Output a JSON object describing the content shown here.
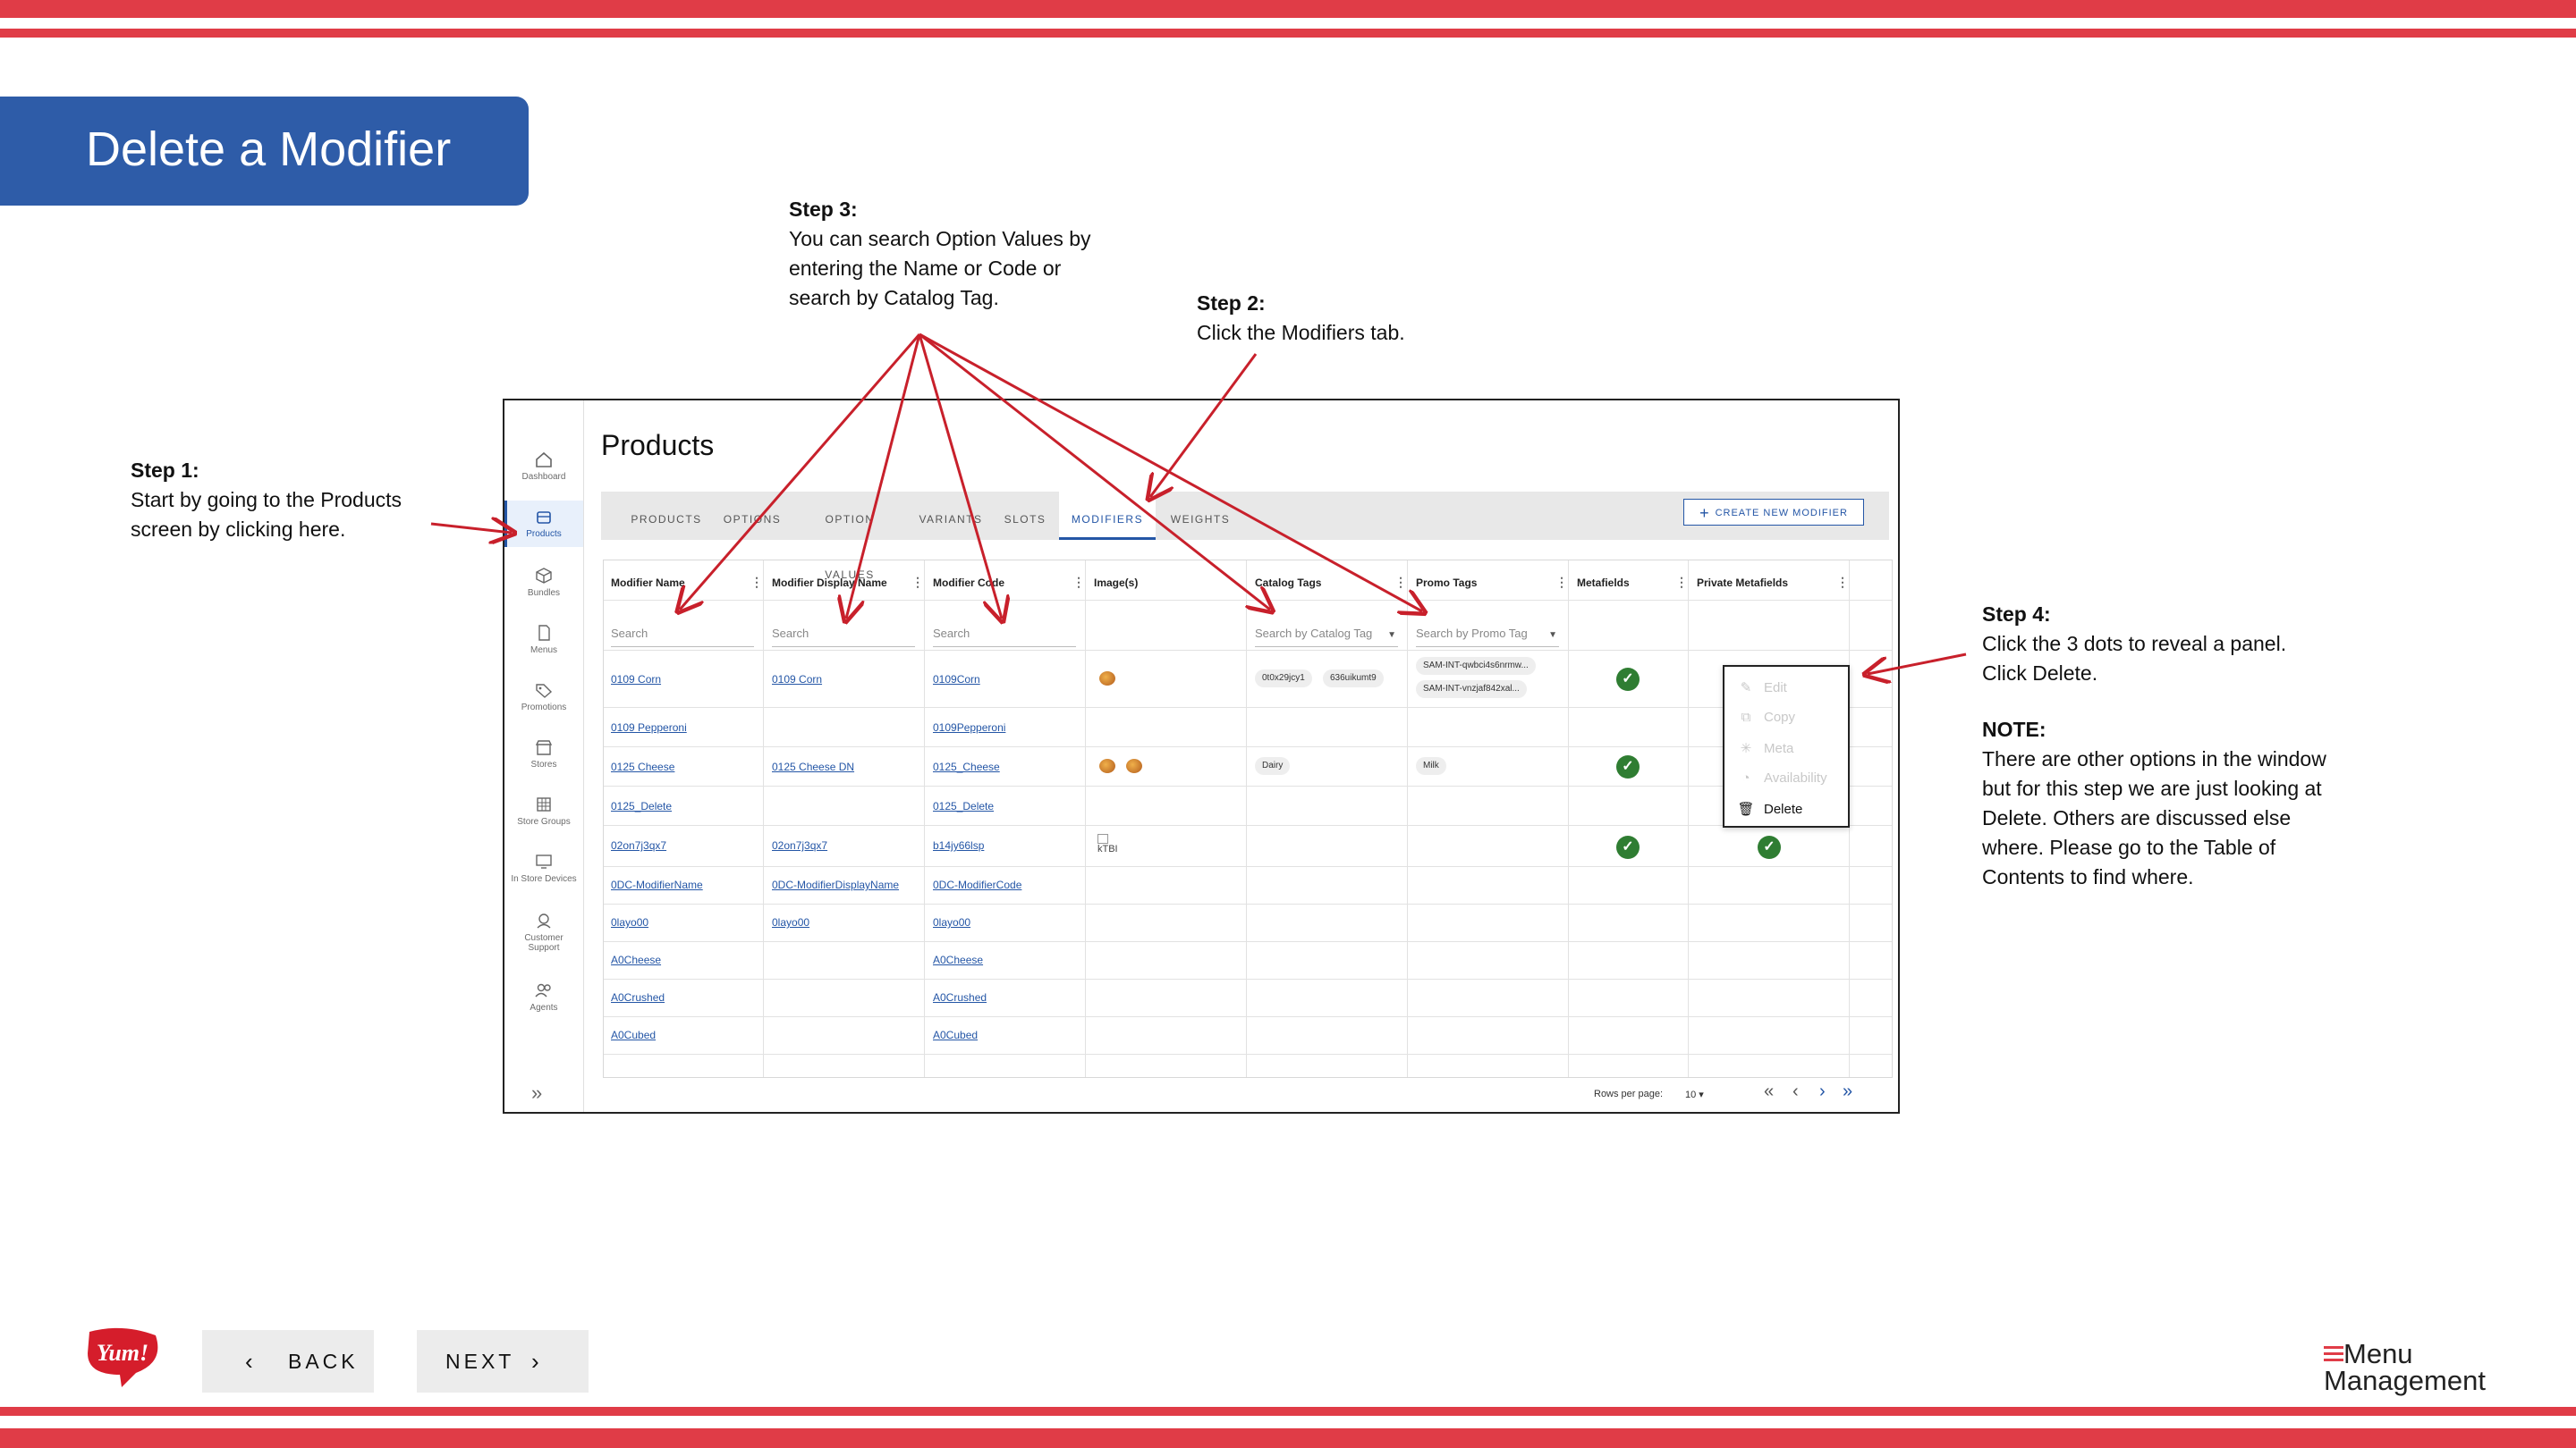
{
  "slide": {
    "title": "Delete a Modifier",
    "step1": {
      "heading": "Step 1:",
      "lines": [
        "Start by going to the Products",
        "screen by clicking here."
      ]
    },
    "step2": {
      "heading": "Step 2:",
      "lines": [
        "Click the Modifiers tab."
      ]
    },
    "step3": {
      "heading": "Step 3:",
      "lines": [
        "You can search Option Values by",
        "entering the Name or Code or",
        "search by Catalog Tag."
      ]
    },
    "step4": {
      "heading": "Step 4:",
      "lines": [
        "Click the 3 dots to reveal a panel.",
        "Click Delete."
      ]
    },
    "note": {
      "heading": "NOTE:",
      "lines": [
        "There are other options in the window",
        "but for this step we are just looking at",
        "Delete. Others are discussed else",
        "where. Please go to the Table of",
        "Contents to find where."
      ]
    },
    "back_label": "BACK",
    "next_label": "NEXT",
    "brand_logo_text": "Yum!",
    "footer_logo": [
      "Menu",
      "Management"
    ],
    "accent_color": "#e03c47",
    "title_color": "#2e5ca8"
  },
  "app": {
    "page_title": "Products",
    "rail": [
      {
        "label": "Dashboard",
        "icon": "home-icon"
      },
      {
        "label": "Products",
        "icon": "box-icon"
      },
      {
        "label": "Bundles",
        "icon": "cube-icon"
      },
      {
        "label": "Menus",
        "icon": "document-icon"
      },
      {
        "label": "Promotions",
        "icon": "tag-icon"
      },
      {
        "label": "Stores",
        "icon": "store-icon"
      },
      {
        "label": "Store Groups",
        "icon": "grid-icon"
      },
      {
        "label": "In Store Devices",
        "icon": "monitor-icon"
      },
      {
        "label": "Customer",
        "label2": "Support",
        "icon": "support-icon"
      },
      {
        "label": "Agents",
        "icon": "people-icon"
      }
    ],
    "tabs": [
      "PRODUCTS",
      "OPTIONS",
      "OPTION VALUES",
      "VARIANTS",
      "SLOTS",
      "MODIFIERS",
      "WEIGHTS"
    ],
    "active_tab": "MODIFIERS",
    "create_button": "CREATE NEW MODIFIER",
    "columns": [
      "Modifier Name",
      "Modifier Display Name",
      "Modifier Code",
      "Image(s)",
      "Catalog Tags",
      "Promo Tags",
      "Metafields",
      "Private Metafields"
    ],
    "search_placeholders": [
      "Search",
      "Search",
      "Search",
      "Search by Catalog Tag",
      "Search by Promo Tag"
    ],
    "rows": [
      {
        "name": "0109 Corn",
        "display": "0109 Corn",
        "code": "0109Corn",
        "images": 1,
        "catalog_tags": [
          "0t0x29jcy1",
          "636uikumt9"
        ],
        "promo_tags": [
          "SAM-INT-qwbci4s6nrmw...",
          "SAM-INT-vnzjaf842xal..."
        ],
        "metafields": true,
        "private_metafields": false
      },
      {
        "name": "0109 Pepperoni",
        "display": "",
        "code": "0109Pepperoni",
        "images": 0,
        "catalog_tags": [],
        "promo_tags": [],
        "metafields": false,
        "private_metafields": false
      },
      {
        "name": "0125 Cheese",
        "display": "0125 Cheese DN",
        "code": "0125_Cheese",
        "images": 2,
        "catalog_tags": [
          "Dairy"
        ],
        "promo_tags": [
          "Milk"
        ],
        "metafields": true,
        "private_metafields": false
      },
      {
        "name": "0125_Delete",
        "display": "",
        "code": "0125_Delete",
        "images": 0,
        "catalog_tags": [],
        "promo_tags": [],
        "metafields": false,
        "private_metafields": false
      },
      {
        "name": "02on7j3qx7",
        "display": "02on7j3qx7",
        "code": "b14jy66lsp",
        "image_alt": "kTBI",
        "catalog_tags": [],
        "promo_tags": [],
        "metafields": true,
        "private_metafields": true
      },
      {
        "name": "0DC-ModifierName",
        "display": "0DC-ModifierDisplayName",
        "code": "0DC-ModifierCode",
        "images": 0,
        "catalog_tags": [],
        "promo_tags": [],
        "metafields": false,
        "private_metafields": false
      },
      {
        "name": "0layo00",
        "display": "0layo00",
        "code": "0layo00",
        "images": 0,
        "catalog_tags": [],
        "promo_tags": [],
        "metafields": false,
        "private_metafields": false
      },
      {
        "name": "A0Cheese",
        "display": "",
        "code": "A0Cheese",
        "images": 0,
        "catalog_tags": [],
        "promo_tags": [],
        "metafields": false,
        "private_metafields": false
      },
      {
        "name": "A0Crushed",
        "display": "",
        "code": "A0Crushed",
        "images": 0,
        "catalog_tags": [],
        "promo_tags": [],
        "metafields": false,
        "private_metafields": false
      },
      {
        "name": "A0Cubed",
        "display": "",
        "code": "A0Cubed",
        "images": 0,
        "catalog_tags": [],
        "promo_tags": [],
        "metafields": false,
        "private_metafields": false
      }
    ],
    "context_menu": [
      "Edit",
      "Copy",
      "Meta",
      "Availability",
      "Delete"
    ],
    "rows_per_page_label": "Rows per page:",
    "rows_per_page_value": "10"
  }
}
